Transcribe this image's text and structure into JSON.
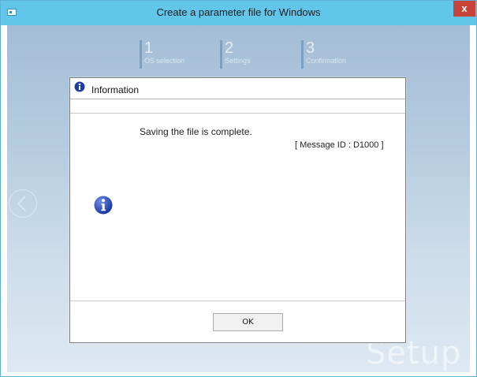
{
  "window": {
    "title": "Create a parameter file for Windows",
    "close_label": "x"
  },
  "steps": [
    {
      "number": "1",
      "label": "OS selection"
    },
    {
      "number": "2",
      "label": "Settings"
    },
    {
      "number": "3",
      "label": "Confirmation"
    }
  ],
  "watermark": "Setup",
  "dialog": {
    "title": "Information",
    "message": "Saving the file is complete.",
    "message_id": "[ Message ID : D1000 ]",
    "ok_label": "OK"
  },
  "icons": {
    "title_icon": "info-icon",
    "dialog_icon": "info-icon",
    "back": "back-arrow-icon"
  },
  "colors": {
    "titlebar": "#62c6ea",
    "close_button": "#c9423a",
    "info_icon": "#1f3fa8"
  }
}
